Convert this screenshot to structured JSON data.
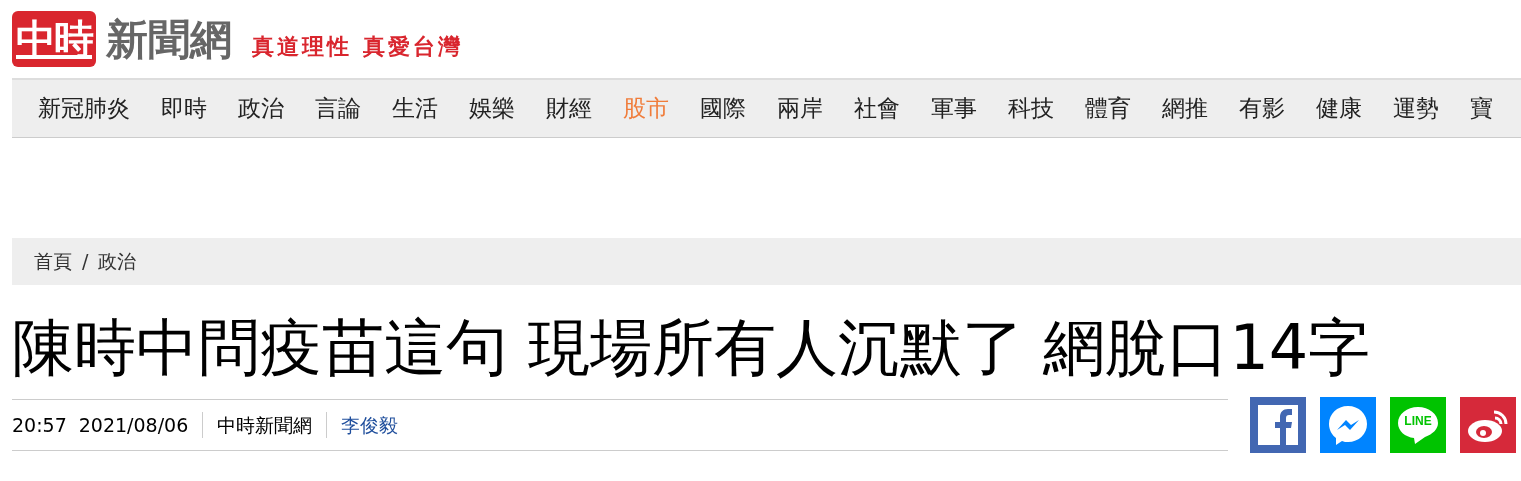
{
  "header": {
    "logo_mark": "中時",
    "logo_text": "新聞網",
    "slogan": "真道理性 真愛台灣"
  },
  "nav": [
    {
      "label": "新冠肺炎",
      "selected": false
    },
    {
      "label": "即時",
      "selected": false
    },
    {
      "label": "政治",
      "selected": false
    },
    {
      "label": "言論",
      "selected": false
    },
    {
      "label": "生活",
      "selected": false
    },
    {
      "label": "娛樂",
      "selected": false
    },
    {
      "label": "財經",
      "selected": false
    },
    {
      "label": "股市",
      "selected": true
    },
    {
      "label": "國際",
      "selected": false
    },
    {
      "label": "兩岸",
      "selected": false
    },
    {
      "label": "社會",
      "selected": false
    },
    {
      "label": "軍事",
      "selected": false
    },
    {
      "label": "科技",
      "selected": false
    },
    {
      "label": "體育",
      "selected": false
    },
    {
      "label": "網推",
      "selected": false
    },
    {
      "label": "有影",
      "selected": false
    },
    {
      "label": "健康",
      "selected": false
    },
    {
      "label": "運勢",
      "selected": false
    },
    {
      "label": "寶",
      "selected": false
    }
  ],
  "breadcrumb": {
    "separator": "/",
    "items": [
      "首頁",
      "政治"
    ]
  },
  "article": {
    "title": "陳時中問疫苗這句 現場所有人沉默了 網脫口14字",
    "time": "20:57",
    "date": "2021/08/06",
    "source": "中時新聞網",
    "author": "李俊毅"
  },
  "share": [
    {
      "kind": "facebook"
    },
    {
      "kind": "messenger"
    },
    {
      "kind": "line",
      "label": "LINE"
    },
    {
      "kind": "weibo"
    }
  ]
}
